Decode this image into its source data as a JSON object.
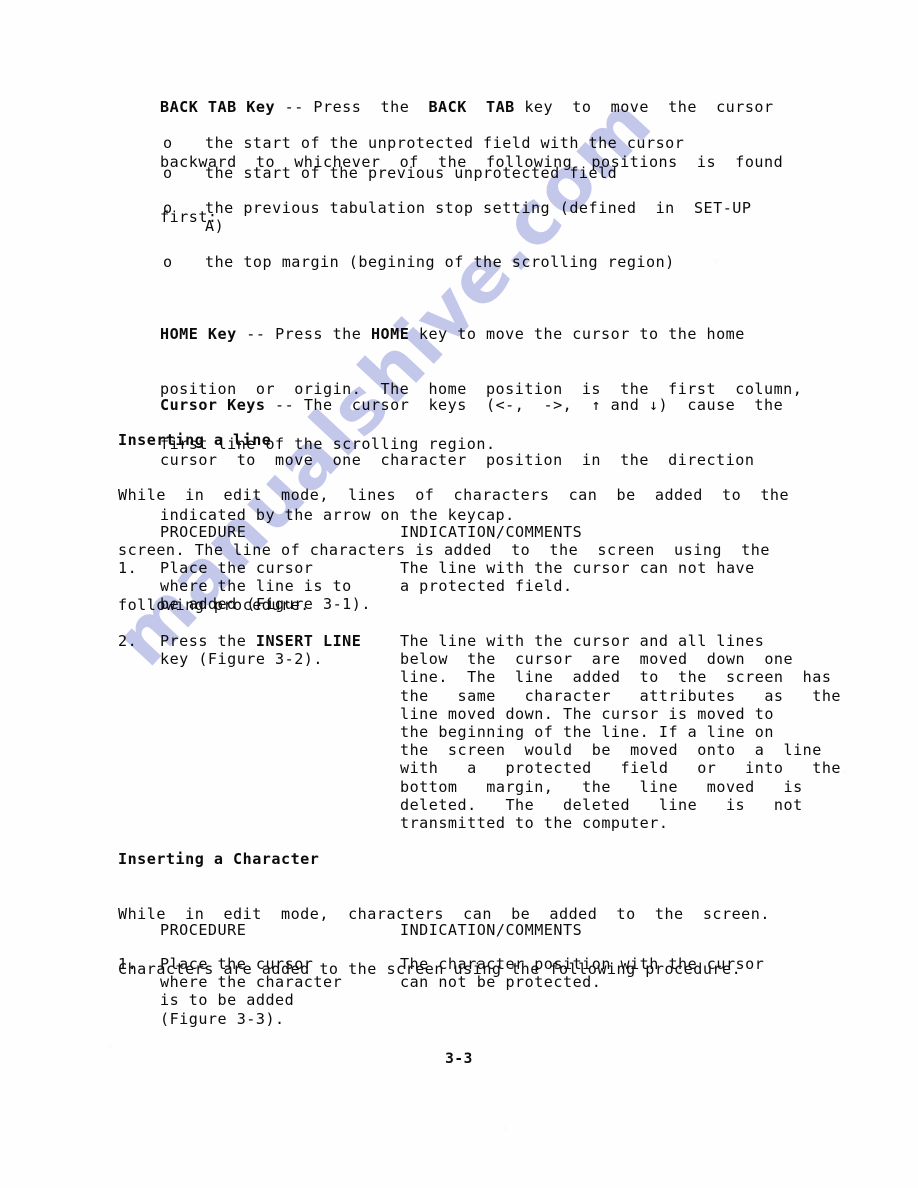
{
  "page": {
    "folio": "3-3",
    "watermark_text": "manualshive.com",
    "watermark_color": "#c3c7ea",
    "ink_color": "#0b0b0b",
    "paper_color": "#fefefe"
  },
  "back_tab": {
    "term": "BACK TAB Key",
    "dash": " -- ",
    "line1_a": "Press  the  ",
    "line1_key": "BACK  TAB",
    "line1_b": " key  to  move  the  cursor",
    "line2": "backward  to  whichever  of  the  following  positions  is  found",
    "line3": "first:",
    "bullets": [
      "the start of the unprotected field with the cursor",
      "the start of the previous unprotected field",
      "the previous tabulation stop setting (defined  in  SET-UP",
      "A)",
      "the top margin (begining of the scrolling region)"
    ],
    "bullet_mark": "o"
  },
  "home_key": {
    "term": "HOME Key",
    "dash": " -- ",
    "line1_a": "Press the ",
    "line1_key": "HOME",
    "line1_b": " key to move the cursor to the home",
    "line2": "position  or  origin.  The  home  position  is  the  first  column,",
    "line3": "first line of the scrolling region."
  },
  "cursor_keys": {
    "term": "Cursor Keys",
    "dash": " -- ",
    "line1": "The  cursor  keys  (<-,  ->,  ↑ and ↓)  cause  the",
    "line2": "cursor  to  move  one  character  position  in  the  direction",
    "line3": "indicated by the arrow on the keycap."
  },
  "inserting_line": {
    "heading": "Inserting a line",
    "line1": "While  in  edit  mode,  lines  of  characters  can  be  added  to  the",
    "line2": "screen. The line of characters is added  to  the  screen  using  the",
    "line3": "following procedure.",
    "col_head_a": "PROCEDURE",
    "col_head_b": "INDICATION/COMMENTS",
    "steps": [
      {
        "number": "1.",
        "procedure": [
          "Place the cursor",
          "where the line is to",
          "be added (Figure 3-1)."
        ],
        "indication": [
          "The line with the cursor can not have",
          "a protected field."
        ]
      },
      {
        "number": "2.",
        "procedure_a": "Press the ",
        "procedure_key": "INSERT LINE",
        "procedure_rest": [
          "key (Figure 3-2)."
        ],
        "indication": [
          "The line with the cursor and all lines",
          "below  the  cursor  are  moved  down  one",
          "line.  The  line  added  to  the  screen  has",
          "the   same   character   attributes   as   the",
          "line moved down. The cursor is moved to",
          "the beginning of the line. If a line on",
          "the  screen  would  be  moved  onto  a  line",
          "with   a   protected   field   or   into   the",
          "bottom   margin,   the   line   moved   is",
          "deleted.   The   deleted   line   is   not",
          "transmitted to the computer."
        ]
      }
    ]
  },
  "inserting_character": {
    "heading": "Inserting a Character",
    "line1": "While  in  edit  mode,  characters  can  be  added  to  the  screen.",
    "line2": "Characters are added to the screen using the following procedure.",
    "col_head_a": "PROCEDURE",
    "col_head_b": "INDICATION/COMMENTS",
    "steps": [
      {
        "number": "1.",
        "procedure": [
          "Place the cursor",
          "where the character",
          "is to be added",
          "(Figure 3-3)."
        ],
        "indication": [
          "The character position with the cursor",
          "can not be protected."
        ]
      }
    ]
  }
}
